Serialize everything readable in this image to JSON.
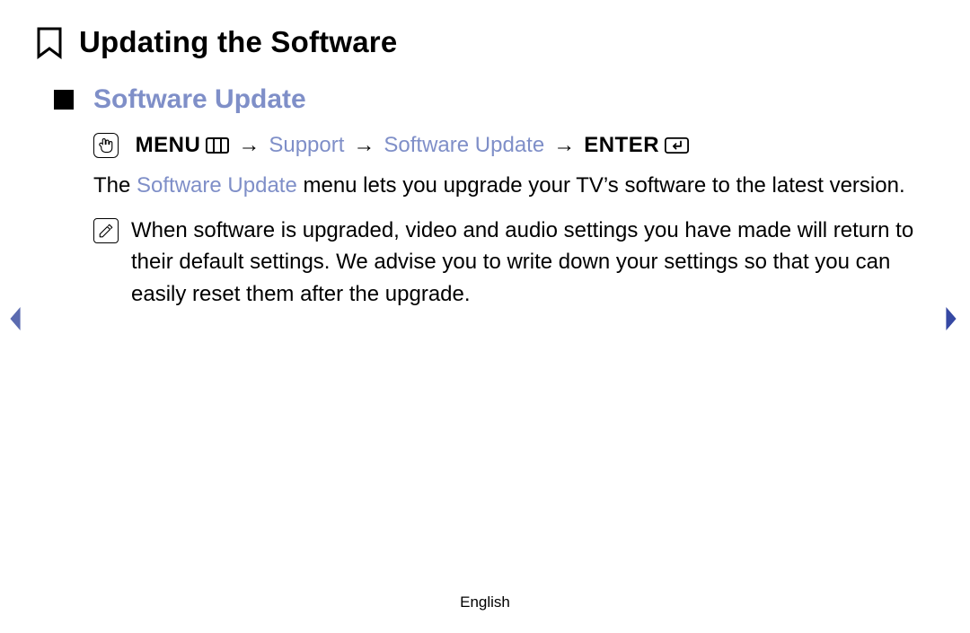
{
  "heading": "Updating the Software",
  "subheading": "Software Update",
  "nav": {
    "menu_label": "MENU",
    "step1": "Support",
    "step2": "Software Update",
    "enter_label": "ENTER",
    "arrow": "→"
  },
  "body": {
    "prefix": "The ",
    "highlight": "Software Update",
    "suffix": " menu lets you upgrade your TV’s software to the latest version."
  },
  "note": "When software is upgraded, video and audio settings you have made will return to their default settings. We advise you to write down your settings so that you can easily reset them after the upgrade.",
  "footer": "English"
}
